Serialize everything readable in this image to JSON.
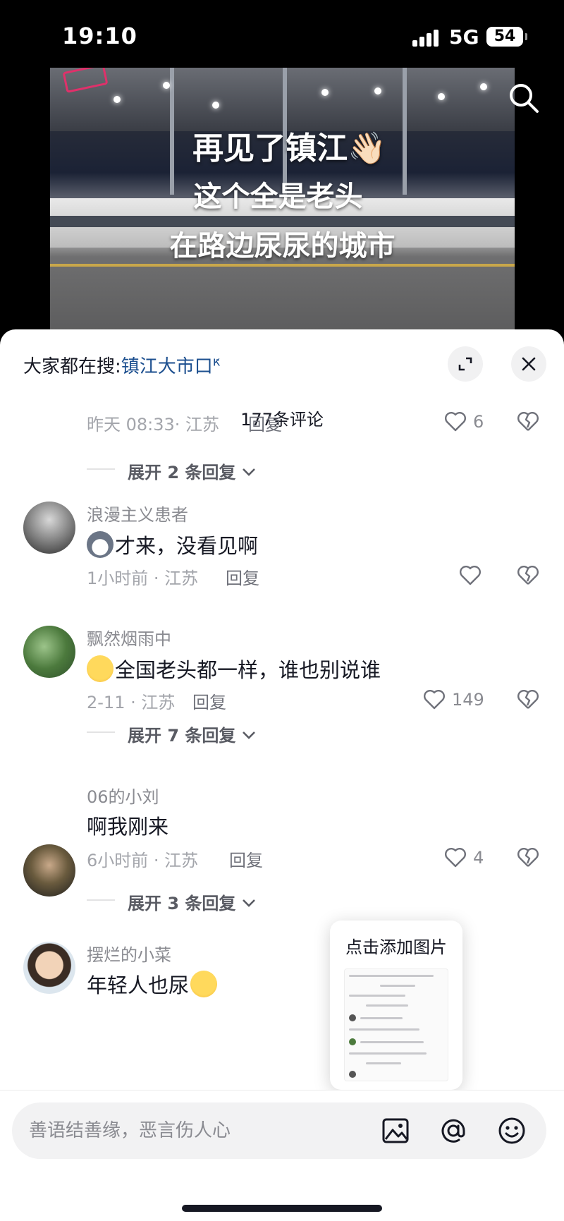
{
  "status_bar": {
    "time": "19:10",
    "network": "5G",
    "battery": "54",
    "battery_level": 0.54
  },
  "video": {
    "lines": [
      "再见了镇江👋🏻",
      "这个全是老头",
      "在路边尿尿的城市"
    ],
    "search_icon": "search-icon"
  },
  "sheet": {
    "search_prefix": "大家都在搜:",
    "search_keyword": "镇江大市口",
    "expand_icon": "expand-icon",
    "close_icon": "close-icon",
    "comment_count": "177条评论"
  },
  "first_comment_tail": {
    "meta": "昨天 08:33· 江苏",
    "reply": "回复",
    "likes": "6",
    "expand": "展开 2 条回复"
  },
  "comments": [
    {
      "user": "浪漫主义患者",
      "text": "才来，没看见啊",
      "emoji": "dog-emoji",
      "meta": "1小时前 · 江苏",
      "reply": "回复",
      "likes": "",
      "expand": ""
    },
    {
      "user": "飘然烟雨中",
      "text": "全国老头都一样，谁也别说谁",
      "emoji": "pleading-emoji",
      "meta": "2-11 · 江苏",
      "reply": "回复",
      "likes": "149",
      "expand": "展开 7 条回复"
    },
    {
      "user": "06的小刘",
      "text": "啊我刚来",
      "emoji": "",
      "meta": "6小时前 · 江苏",
      "reply": "回复",
      "likes": "4",
      "expand": "展开 3 条回复"
    },
    {
      "user": "摆烂的小菜",
      "text": "年轻人也尿",
      "emoji": "rofl-emoji",
      "meta": "",
      "reply": "",
      "likes": "",
      "expand": ""
    }
  ],
  "popup": {
    "title": "点击添加图片"
  },
  "input": {
    "placeholder": "善语结善缘，恶言伤人心",
    "image_icon": "image-icon",
    "at_icon": "at-icon",
    "emoji_icon": "emoji-icon"
  },
  "colors": {
    "link": "#1c4f8f",
    "meta": "#a3a5ab",
    "text": "#161823"
  }
}
